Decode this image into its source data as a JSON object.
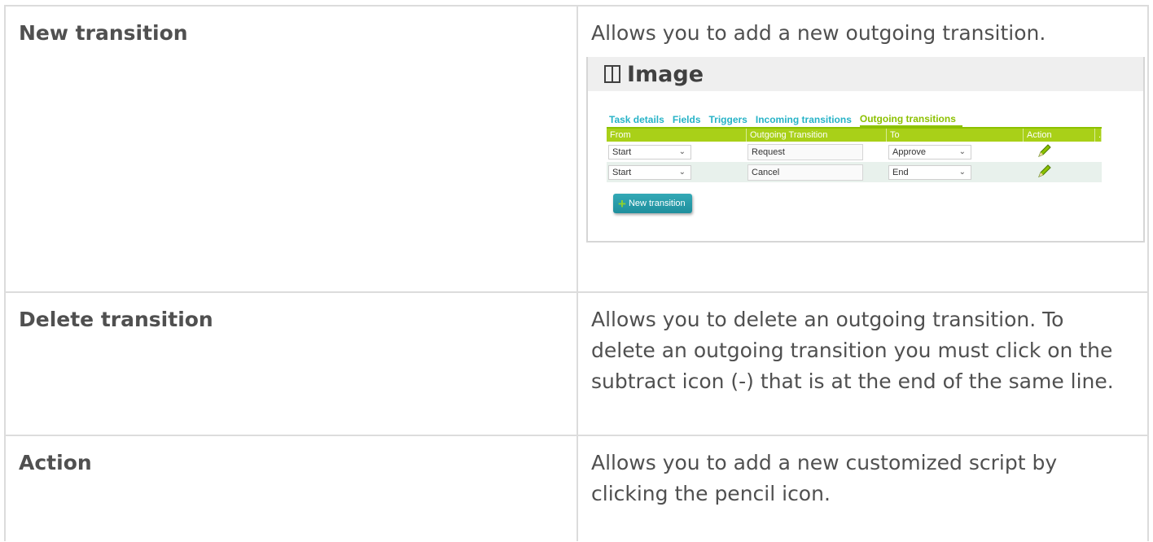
{
  "rows": [
    {
      "term": "New transition",
      "description": "Allows you to add a new outgoing transition."
    },
    {
      "term": "Delete transition",
      "description": "Allows you to delete an outgoing transition. To delete an outgoing transition you must click on the subtract icon (-) that is at the end of the same line."
    },
    {
      "term": "Action",
      "description": "Allows you to add a new customized script by clicking the pencil icon."
    }
  ],
  "image_panel": {
    "title": "Image",
    "tabs": [
      "Task details",
      "Fields",
      "Triggers",
      "Incoming transitions",
      "Outgoing transitions"
    ],
    "active_tab": "Outgoing transitions",
    "columns": [
      "From",
      "Outgoing Transition",
      "To",
      "Action",
      "."
    ],
    "grid_rows": [
      {
        "from": "Start",
        "transition": "Request",
        "to": "Approve"
      },
      {
        "from": "Start",
        "transition": "Cancel",
        "to": "End"
      }
    ],
    "new_button": "New transition",
    "colors": {
      "accent_green": "#a9d018",
      "tab_blue": "#27b3c7",
      "button_teal": "#2aa0ae"
    }
  }
}
